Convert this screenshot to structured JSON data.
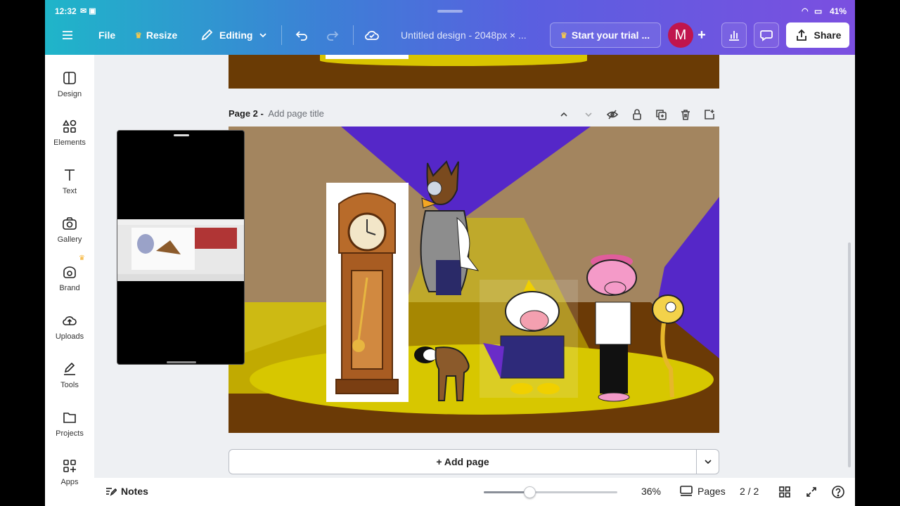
{
  "status_bar": {
    "time": "12:32",
    "battery": "41%"
  },
  "topbar": {
    "file_label": "File",
    "resize_label": "Resize",
    "editing_label": "Editing",
    "doc_title": "Untitled design - 2048px × ...",
    "trial_label": "Start your trial ...",
    "avatar_letter": "M",
    "share_label": "Share"
  },
  "sidebar": {
    "items": [
      {
        "label": "Design",
        "icon": "design-icon"
      },
      {
        "label": "Elements",
        "icon": "elements-icon"
      },
      {
        "label": "Text",
        "icon": "text-icon"
      },
      {
        "label": "Gallery",
        "icon": "camera-icon"
      },
      {
        "label": "Brand",
        "icon": "brand-icon"
      },
      {
        "label": "Uploads",
        "icon": "upload-cloud-icon"
      },
      {
        "label": "Tools",
        "icon": "pen-icon"
      },
      {
        "label": "Projects",
        "icon": "folder-icon"
      },
      {
        "label": "Apps",
        "icon": "apps-icon"
      }
    ]
  },
  "page2": {
    "number_label": "Page 2 -",
    "title_placeholder": "Add page title"
  },
  "add_page_label": "+ Add page",
  "bottom": {
    "notes_label": "Notes",
    "zoom": "36%",
    "pages_label": "Pages",
    "page_count": "2 / 2",
    "zoom_fraction": 0.34
  },
  "colors": {
    "accent": "#8b3dff",
    "avatar_bg": "#c0154d"
  }
}
